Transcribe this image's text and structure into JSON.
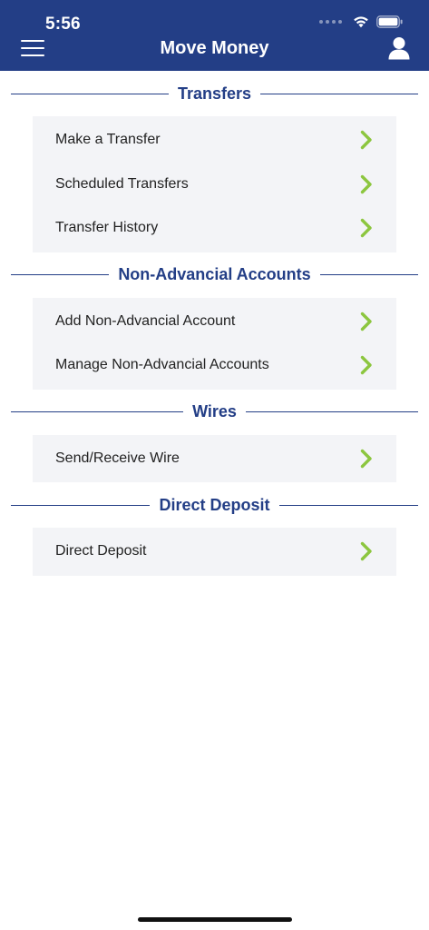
{
  "status_bar": {
    "time": "5:56"
  },
  "header": {
    "title": "Move Money",
    "menu_icon": "hamburger-menu-icon",
    "profile_icon": "user-profile-icon"
  },
  "colors": {
    "brand": "#233e86",
    "chevron": "#8cc63f",
    "card_bg": "#f3f4f7"
  },
  "sections": [
    {
      "title": "Transfers",
      "items": [
        {
          "label": "Make a Transfer"
        },
        {
          "label": "Scheduled Transfers"
        },
        {
          "label": "Transfer History"
        }
      ]
    },
    {
      "title": "Non-Advancial Accounts",
      "items": [
        {
          "label": "Add Non-Advancial Account"
        },
        {
          "label": "Manage Non-Advancial Accounts"
        }
      ]
    },
    {
      "title": "Wires",
      "items": [
        {
          "label": "Send/Receive Wire"
        }
      ]
    },
    {
      "title": "Direct Deposit",
      "items": [
        {
          "label": "Direct Deposit"
        }
      ]
    }
  ]
}
